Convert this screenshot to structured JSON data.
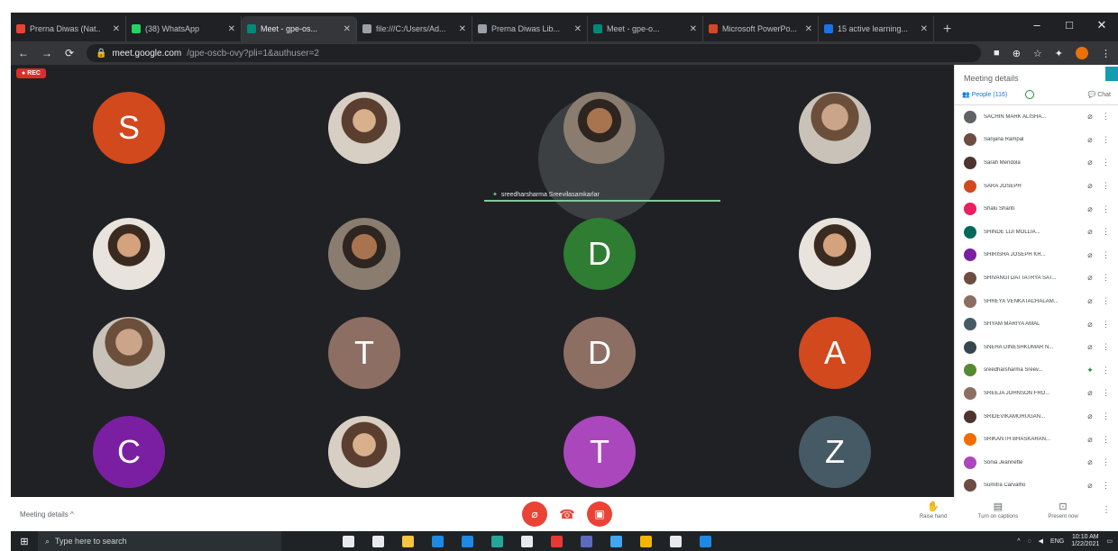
{
  "browser": {
    "tabs": [
      {
        "label": "Prerna Diwas (Nat..",
        "color": "#ea4335",
        "active": false
      },
      {
        "label": "(38) WhatsApp",
        "color": "#25d366",
        "active": false
      },
      {
        "label": "Meet - gpe-os...",
        "color": "#00897b",
        "active": true
      },
      {
        "label": "file:///C:/Users/Ad...",
        "color": "#9aa0a6",
        "active": false
      },
      {
        "label": "Prerna Diwas Lib...",
        "color": "#9aa0a6",
        "active": false
      },
      {
        "label": "Meet - gpe-o...",
        "color": "#00897b",
        "active": false
      },
      {
        "label": "Microsoft PowerPo...",
        "color": "#d24726",
        "active": false
      },
      {
        "label": "15 active learning...",
        "color": "#1a73e8",
        "active": false
      }
    ],
    "new_tab": "+",
    "window_controls": [
      "–",
      "□",
      "✕"
    ],
    "url_host": "meet.google.com",
    "url_path": "/gpe-oscb-ovy?pli=1&authuser=2"
  },
  "meet": {
    "rec_label": "● REC",
    "presenter_name": "sreedharsharma Sreevilasamkarlar",
    "tiles": [
      {
        "kind": "letter",
        "letter": "S",
        "color": "#d2491e"
      },
      {
        "kind": "photo",
        "style": "photo4"
      },
      {
        "kind": "photo",
        "style": "photo3"
      },
      {
        "kind": "photo",
        "style": "photo"
      },
      {
        "kind": "photo",
        "style": "photo2"
      },
      {
        "kind": "photo",
        "style": "photo3"
      },
      {
        "kind": "letter",
        "letter": "D",
        "color": "#2e7d32"
      },
      {
        "kind": "photo",
        "style": "photo2"
      },
      {
        "kind": "photo",
        "style": "photo"
      },
      {
        "kind": "letter",
        "letter": "T",
        "color": "#8d6e63"
      },
      {
        "kind": "letter",
        "letter": "D",
        "color": "#8d6e63"
      },
      {
        "kind": "letter",
        "letter": "A",
        "color": "#d2491e"
      },
      {
        "kind": "letter",
        "letter": "C",
        "color": "#7b1fa2"
      },
      {
        "kind": "photo",
        "style": "photo4"
      },
      {
        "kind": "letter",
        "letter": "T",
        "color": "#ab47bc"
      },
      {
        "kind": "letter",
        "letter": "Z",
        "color": "#455a64"
      }
    ]
  },
  "panel": {
    "title": "Meeting details",
    "people_tab": "People (116)",
    "chat_tab": "Chat",
    "participants": [
      {
        "name": "SACHIN MARK ALISHA...",
        "color": "#5f6368",
        "mic_on": false
      },
      {
        "name": "Sanjana Rampal",
        "color": "#6d4c41",
        "mic_on": false
      },
      {
        "name": "Sarah Mendola",
        "color": "#4e342e",
        "mic_on": false
      },
      {
        "name": "SARA JOSEPH",
        "color": "#d2491e",
        "mic_on": false
      },
      {
        "name": "Shalu Shanti",
        "color": "#e91e63",
        "mic_on": false
      },
      {
        "name": "SHINDE LIJI MOLLIA...",
        "color": "#00695c",
        "mic_on": false
      },
      {
        "name": "SHIRISHA JOSEPH KR...",
        "color": "#7b1fa2",
        "mic_on": false
      },
      {
        "name": "SHIVANGI DATTATRYA SAT...",
        "color": "#6d4c41",
        "mic_on": false
      },
      {
        "name": "SHREYA VENKATACHALAM...",
        "color": "#8d6e63",
        "mic_on": false
      },
      {
        "name": "SHYAM MARIYA AMAL",
        "color": "#455a64",
        "mic_on": false
      },
      {
        "name": "SNEHA DINESHKUMAR N...",
        "color": "#37474f",
        "mic_on": false
      },
      {
        "name": "sreedharsharma Sreev...",
        "color": "#558b2f",
        "mic_on": true
      },
      {
        "name": "SREEJA JOHNSON FRO...",
        "color": "#8d6e63",
        "mic_on": false
      },
      {
        "name": "SRIDEVIKAMURUGAN...",
        "color": "#4e342e",
        "mic_on": false
      },
      {
        "name": "SRIKANTH BHASKARAN...",
        "color": "#ef6c00",
        "mic_on": false
      },
      {
        "name": "Sonia Jeannette",
        "color": "#ab47bc",
        "mic_on": false
      },
      {
        "name": "Sumitra Carvalho",
        "color": "#6d4c41",
        "mic_on": false
      }
    ]
  },
  "bottom": {
    "meeting_details": "Meeting details  ^",
    "raise_hand": "Raise hand",
    "captions": "Turn on captions",
    "present": "Present now"
  },
  "taskbar": {
    "search_placeholder": "Type here to search",
    "apps": [
      "#e8eaed",
      "#e8eaed",
      "#f6c342",
      "#1e88e5",
      "#1e88e5",
      "#26a69a",
      "#e8eaed",
      "#e53935",
      "#5c6bc0",
      "#42a5f5",
      "#f4b400",
      "#e8eaed",
      "#1e88e5"
    ],
    "lang": "ENG",
    "time": "10:10 AM",
    "date": "1/22/2021"
  }
}
